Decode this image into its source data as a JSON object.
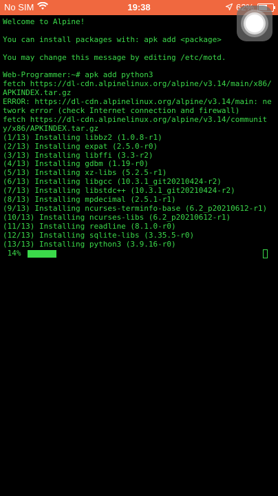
{
  "status_bar": {
    "carrier": "No SIM",
    "time": "19:38",
    "battery_percent": "62%",
    "battery_level": 0.62,
    "wifi_icon": "wifi-icon",
    "location_icon": "location-arrow-icon",
    "color": "#f0683f"
  },
  "terminal": {
    "text_color": "#3bd94a",
    "background": "#000000",
    "lines": [
      "Welcome to Alpine!",
      "",
      "You can install packages with: apk add <package>",
      "",
      "You may change this message by editing /etc/motd.",
      "",
      "Web-Programmer:~# apk add python3",
      "fetch https://dl-cdn.alpinelinux.org/alpine/v3.14/main/x86/APKINDEX.tar.gz",
      "ERROR: https://dl-cdn.alpinelinux.org/alpine/v3.14/main: network error (check Internet connection and firewall)",
      "fetch https://dl-cdn.alpinelinux.org/alpine/v3.14/community/x86/APKINDEX.tar.gz",
      "(1/13) Installing libbz2 (1.0.8-r1)",
      "(2/13) Installing expat (2.5.0-r0)",
      "(3/13) Installing libffi (3.3-r2)",
      "(4/13) Installing gdbm (1.19-r0)",
      "(5/13) Installing xz-libs (5.2.5-r1)",
      "(6/13) Installing libgcc (10.3.1_git20210424-r2)",
      "(7/13) Installing libstdc++ (10.3.1_git20210424-r2)",
      "(8/13) Installing mpdecimal (2.5.1-r1)",
      "(9/13) Installing ncurses-terminfo-base (6.2_p20210612-r1)",
      "(10/13) Installing ncurses-libs (6.2_p20210612-r1)",
      "(11/13) Installing readline (8.1.0-r0)",
      "(12/13) Installing sqlite-libs (3.35.5-r0)",
      "(13/13) Installing python3 (3.9.16-r0)"
    ],
    "progress": {
      "label": " 14%",
      "fraction": 0.14
    }
  },
  "assistive_touch": {
    "icon": "assistive-touch-icon"
  }
}
